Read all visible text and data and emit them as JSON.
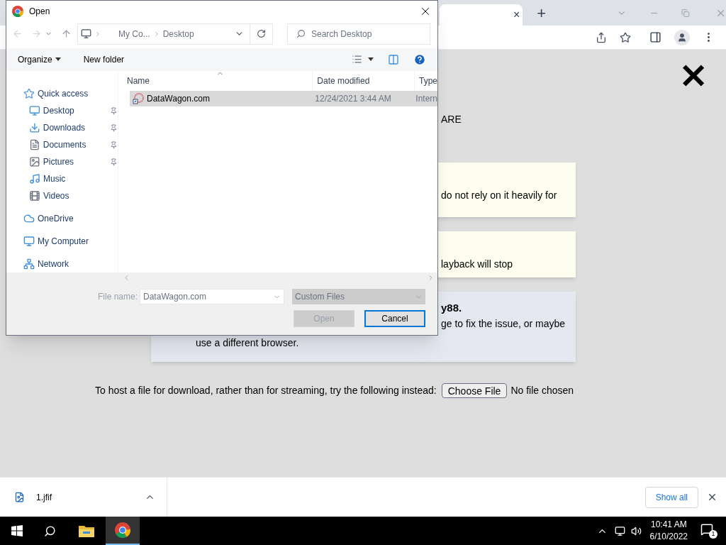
{
  "browser": {
    "tab_close": "×",
    "new_tab": "+"
  },
  "page": {
    "close": "✕",
    "heading_tail": "ARE",
    "notices": [
      {
        "kind": "warning",
        "lines": [
          "do not rely on it heavily for"
        ]
      },
      {
        "kind": "warning",
        "lines": [
          "layback will stop"
        ]
      },
      {
        "kind": "info",
        "title": "y88.",
        "lines": [
          "ge to fix the issue, or maybe",
          "use a different browser."
        ]
      }
    ],
    "host_prompt": "To host a file for download, rather than for streaming, try the following instead:",
    "choose_button": "Choose File",
    "file_status": "No file chosen"
  },
  "dialog": {
    "title": "Open",
    "breadcrumb": [
      "My Co...",
      "Desktop"
    ],
    "search_placeholder": "Search Desktop",
    "toolbar": [
      "Organize",
      "New folder"
    ],
    "sidebar": [
      {
        "label": "Quick access",
        "kind": "star",
        "pinned": false,
        "children": [
          {
            "label": "Desktop",
            "kind": "desktop",
            "pinned": true
          },
          {
            "label": "Downloads",
            "kind": "download",
            "pinned": true
          },
          {
            "label": "Documents",
            "kind": "document",
            "pinned": true
          },
          {
            "label": "Pictures",
            "kind": "picture-folder",
            "pinned": true
          },
          {
            "label": "Music",
            "kind": "music",
            "pinned": false
          },
          {
            "label": "Videos",
            "kind": "video",
            "pinned": false
          }
        ]
      },
      {
        "label": "OneDrive",
        "kind": "cloud",
        "pinned": false
      },
      {
        "label": "My Computer",
        "kind": "computer",
        "pinned": false
      },
      {
        "label": "Network",
        "kind": "network",
        "pinned": false
      }
    ],
    "columns": [
      "Name",
      "Date modified",
      "Type"
    ],
    "files": [
      {
        "name": "DataWagon.com",
        "date": "12/24/2021 3:44 AM",
        "type": "Intern",
        "selected": true
      }
    ],
    "file_name_label": "File name:",
    "file_name": "DataWagon.com",
    "file_type": "Custom Files",
    "buttons": [
      {
        "label": "Open",
        "disabled": true,
        "default": false
      },
      {
        "label": "Cancel",
        "disabled": false,
        "default": true
      }
    ]
  },
  "downloads": {
    "items": [
      {
        "name": "1.jfif"
      }
    ],
    "show_all": "Show all"
  },
  "taskbar": {
    "time": "10:41 AM",
    "date": "6/10/2022",
    "notifications": "1"
  }
}
